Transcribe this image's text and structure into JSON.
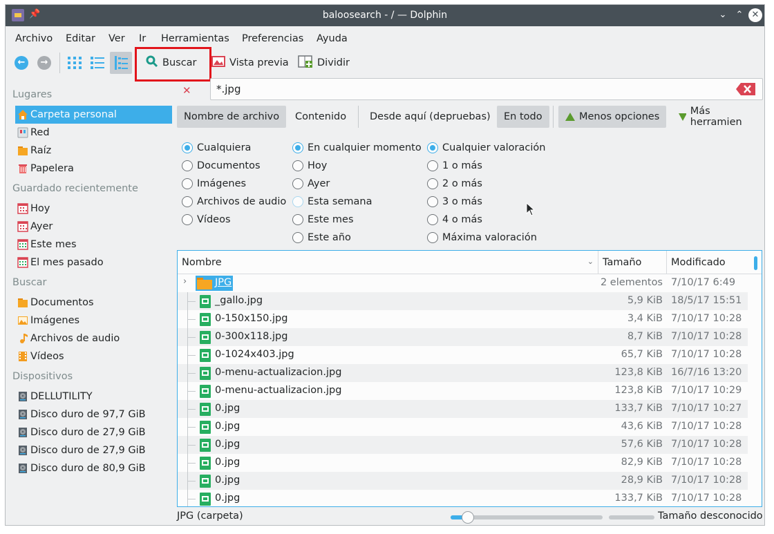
{
  "window": {
    "title": "baloosearch - / — Dolphin"
  },
  "menu": [
    "Archivo",
    "Editar",
    "Ver",
    "Ir",
    "Herramientas",
    "Preferencias",
    "Ayuda"
  ],
  "toolbar": {
    "search_label": "Buscar",
    "preview_label": "Vista previa",
    "split_label": "Dividir"
  },
  "sidebar": {
    "sections": [
      {
        "title": "Lugares",
        "items": [
          {
            "label": "Carpeta personal",
            "icon": "home-icon",
            "selected": true
          },
          {
            "label": "Red",
            "icon": "network-icon"
          },
          {
            "label": "Raíz",
            "icon": "folder-icon"
          },
          {
            "label": "Papelera",
            "icon": "trash-icon"
          }
        ]
      },
      {
        "title": "Guardado recientemente",
        "items": [
          {
            "label": "Hoy",
            "icon": "calendar-icon"
          },
          {
            "label": "Ayer",
            "icon": "calendar-icon"
          },
          {
            "label": "Este mes",
            "icon": "calendar-green-icon"
          },
          {
            "label": "El mes pasado",
            "icon": "calendar-green-icon"
          }
        ]
      },
      {
        "title": "Buscar",
        "items": [
          {
            "label": "Documentos",
            "icon": "folder-icon"
          },
          {
            "label": "Imágenes",
            "icon": "image-icon"
          },
          {
            "label": "Archivos de audio",
            "icon": "music-icon"
          },
          {
            "label": "Vídeos",
            "icon": "film-icon"
          }
        ]
      },
      {
        "title": "Dispositivos",
        "items": [
          {
            "label": "DELLUTILITY",
            "icon": "harddisk-icon"
          },
          {
            "label": "Disco duro de 97,7 GiB",
            "icon": "harddisk-icon"
          },
          {
            "label": "Disco duro de 27,9 GiB",
            "icon": "harddisk-icon"
          },
          {
            "label": "Disco duro de 27,9 GiB",
            "icon": "harddisk-icon"
          },
          {
            "label": "Disco duro de 80,9 GiB",
            "icon": "harddisk-icon"
          }
        ]
      }
    ]
  },
  "search": {
    "value": "*.jpg"
  },
  "search_options": {
    "filename": "Nombre de archivo",
    "content": "Contenido",
    "from_here": "Desde aquí (depruebas)",
    "everywhere": "En todo",
    "less_options": "Menos opciones",
    "more_tools": "Más herramien"
  },
  "filters": {
    "type": [
      "Cualquiera",
      "Documentos",
      "Imágenes",
      "Archivos de audio",
      "Vídeos"
    ],
    "date": [
      "En cualquier momento",
      "Hoy",
      "Ayer",
      "Esta semana",
      "Este mes",
      "Este año"
    ],
    "rating": [
      "Cualquier valoración",
      "1 o más",
      "2 o más",
      "3 o más",
      "4 o más",
      "Máxima valoración"
    ]
  },
  "filelist": {
    "columns": [
      "Nombre",
      "Tamaño",
      "Modificado"
    ],
    "rows": [
      {
        "name": "JPG",
        "size": "2 elementos",
        "modified": "7/10/17 6:49",
        "folder": true
      },
      {
        "name": "_gallo.jpg",
        "size": "5,9 KiB",
        "modified": "18/5/17 15:51"
      },
      {
        "name": "0-150x150.jpg",
        "size": "3,4 KiB",
        "modified": "7/10/17 10:28"
      },
      {
        "name": "0-300x118.jpg",
        "size": "8,7 KiB",
        "modified": "7/10/17 10:28"
      },
      {
        "name": "0-1024x403.jpg",
        "size": "65,7 KiB",
        "modified": "7/10/17 10:28"
      },
      {
        "name": "0-menu-actualizacion.jpg",
        "size": "123,8 KiB",
        "modified": "16/7/16 13:20"
      },
      {
        "name": "0-menu-actualizacion.jpg",
        "size": "123,8 KiB",
        "modified": "7/10/17 10:29"
      },
      {
        "name": "0.jpg",
        "size": "133,7 KiB",
        "modified": "7/10/17 10:27"
      },
      {
        "name": "0.jpg",
        "size": "43,6 KiB",
        "modified": "7/10/17 10:28"
      },
      {
        "name": "0.jpg",
        "size": "57,6 KiB",
        "modified": "7/10/17 10:28"
      },
      {
        "name": "0.jpg",
        "size": "82,9 KiB",
        "modified": "7/10/17 10:28"
      },
      {
        "name": "0.jpg",
        "size": "28,9 KiB",
        "modified": "7/10/17 10:28"
      },
      {
        "name": "0.jpg",
        "size": "133,7 KiB",
        "modified": "7/10/17 10:28"
      }
    ]
  },
  "status": {
    "selection": "JPG (carpeta)",
    "space": "Tamaño desconocido",
    "zoom_level": 0.1
  },
  "colors": {
    "accent": "#3daee9",
    "highlight": "#e2141b",
    "titlebar": "#475057"
  }
}
